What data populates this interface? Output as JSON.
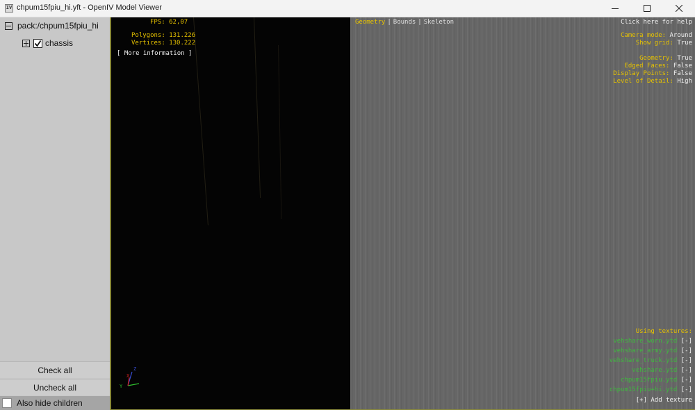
{
  "window": {
    "title": "chpum15fpiu_hi.yft - OpenIV Model Viewer",
    "icon": "openiv-app-icon"
  },
  "tree": {
    "root_label": "pack:/chpum15fpiu_hi",
    "child_label": "chassis",
    "child_checked": true
  },
  "panel": {
    "check_all": "Check all",
    "uncheck_all": "Uncheck all",
    "hide_children": "Also hide children"
  },
  "stats": {
    "fps_label": "FPS:",
    "fps_value": "62,07",
    "polygons_label": "Polygons:",
    "polygons_value": "131.226",
    "vertices_label": "Vertices:",
    "vertices_value": "130.222",
    "more_info": "[ More information ]"
  },
  "tabs": {
    "geometry": "Geometry",
    "separator": "|",
    "bounds": "Bounds",
    "skeleton": "Skeleton"
  },
  "help": "Click here for help",
  "settings": [
    {
      "label": "Camera mode:",
      "value": "Around"
    },
    {
      "label": "Show grid:",
      "value": "True"
    },
    {
      "label": "Geometry:",
      "value": "True"
    },
    {
      "label": "Edged Faces:",
      "value": "False"
    },
    {
      "label": "Display Points:",
      "value": "False"
    },
    {
      "label": "Level of Detail:",
      "value": "High"
    }
  ],
  "textures": {
    "header": "Using textures:",
    "items": [
      {
        "name": "vehshare_worn.ytd",
        "remove": "[-]"
      },
      {
        "name": "vehshare_army.ytd",
        "remove": "[-]"
      },
      {
        "name": "vehshare_truck.ytd",
        "remove": "[-]"
      },
      {
        "name": "vehshare.ytd",
        "remove": "[-]"
      },
      {
        "name": "chpum15fpiu.ytd",
        "remove": "[-]"
      },
      {
        "name": "chpum15fpiu+hi.ytd",
        "remove": "[-]"
      }
    ],
    "add": "[+] Add texture"
  },
  "axis": {
    "x": "X",
    "y": "Y",
    "z": "Z"
  },
  "colors": {
    "accent_yellow": "#e6c200",
    "texture_green": "#3fb83f",
    "viewport_grey": "#666666",
    "viewport_dark": "#040404",
    "panel_grey": "#c8c8c8"
  }
}
